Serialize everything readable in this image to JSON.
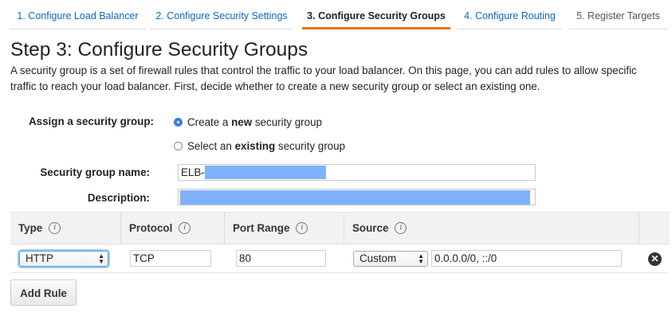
{
  "tabs": [
    {
      "label": "1. Configure Load Balancer"
    },
    {
      "label": "2. Configure Security Settings"
    },
    {
      "label": "3. Configure Security Groups"
    },
    {
      "label": "4. Configure Routing"
    },
    {
      "label": "5. Register Targets"
    }
  ],
  "page": {
    "title": "Step 3: Configure Security Groups",
    "description": "A security group is a set of firewall rules that control the traffic to your load balancer. On this page, you can add rules to allow specific traffic to reach your load balancer. First, decide whether to create a new security group or select an existing one."
  },
  "form": {
    "assign_label": "Assign a security group:",
    "option_create": {
      "pre": "Create a ",
      "bold": "new",
      "post": " security group",
      "checked": true
    },
    "option_select": {
      "pre": "Select an ",
      "bold": "existing",
      "post": " security group",
      "checked": false
    },
    "name_label": "Security group name:",
    "name_value": "ELB-",
    "description_label": "Description:"
  },
  "rules": {
    "headers": {
      "type": "Type",
      "protocol": "Protocol",
      "port_range": "Port Range",
      "source": "Source"
    },
    "info_glyph": "i",
    "row": {
      "type": "HTTP",
      "protocol": "TCP",
      "port_range": "80",
      "source_mode": "Custom",
      "source_value": "0.0.0.0/0, ::/0",
      "remove_icon": "close-circle-icon"
    },
    "add_rule_label": "Add Rule"
  },
  "colors": {
    "accent": "#ec7211",
    "link": "#1166bb",
    "radio": "#3b7ddd",
    "redaction": "#7fb2fb"
  }
}
